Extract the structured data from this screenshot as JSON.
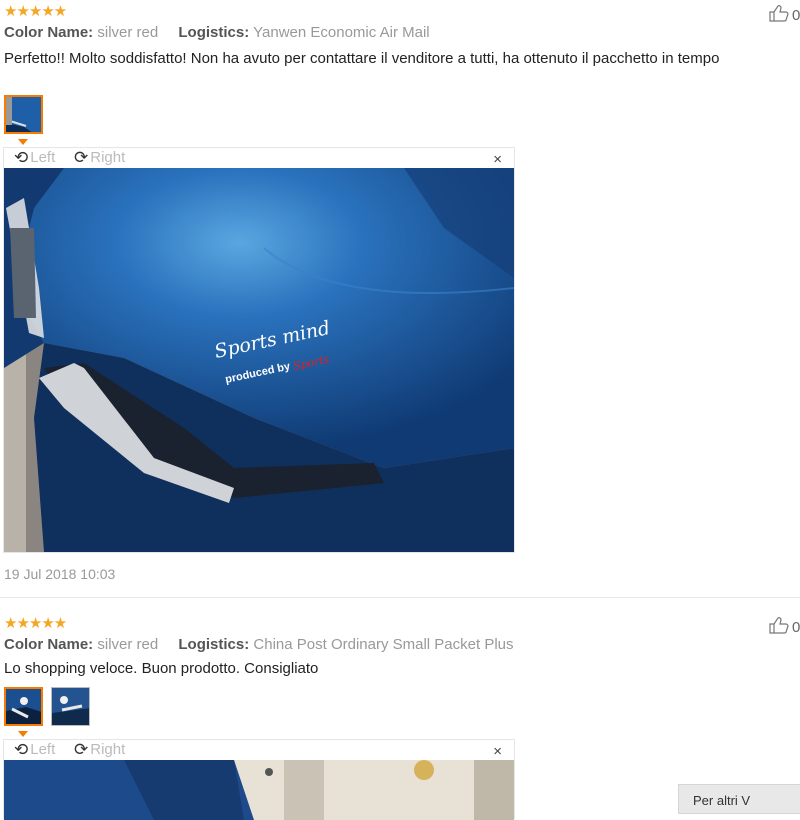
{
  "reviews": [
    {
      "stars": "★★★★★",
      "color_label": "Color Name:",
      "color_value": "silver red",
      "logistics_label": "Logistics:",
      "logistics_value": "Yanwen Economic Air Mail",
      "comment": "Perfetto!! Molto soddisfatto! Non ha avuto per contattare il venditore a tutti, ha ottenuto il pacchetto in tempo",
      "helpful": "0",
      "viewer": {
        "rotate_left": "Left",
        "rotate_right": "Right",
        "close": "×"
      },
      "photo_sticker_script": "Sports mind",
      "photo_sticker_line": "produced by",
      "photo_sticker_brand": "Sports",
      "date": "19 Jul 2018 10:03"
    },
    {
      "stars": "★★★★★",
      "color_label": "Color Name:",
      "color_value": "silver red",
      "logistics_label": "Logistics:",
      "logistics_value": "China Post Ordinary Small Packet Plus",
      "comment": "Lo shopping veloce. Buon prodotto. Consigliato",
      "helpful": "0",
      "viewer": {
        "rotate_left": "Left",
        "rotate_right": "Right",
        "close": "×"
      }
    }
  ],
  "more_button": "Per altri V",
  "colors": {
    "star": "#f5a623",
    "accent": "#f57c00",
    "car_blue": "#1f5fa8"
  }
}
